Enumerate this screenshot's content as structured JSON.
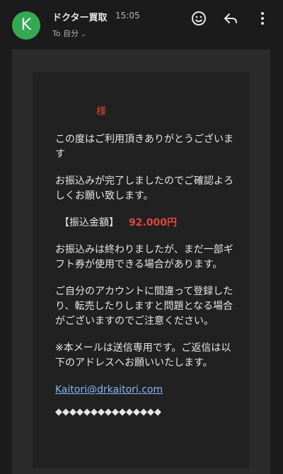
{
  "header": {
    "avatar_letter": "K",
    "sender": "ドクター買取",
    "time": "15:05",
    "to": "To 自分",
    "icons": [
      "smile-icon",
      "reply-icon",
      "more-vert-icon"
    ],
    "avatar_color": "#34a853"
  },
  "email": {
    "sama": "様",
    "para1": "この度はご利用頂きありがとうございます",
    "para2": "お振込みが完了しましたのでご確認よろしくお願い致します。",
    "amount_label": "【振込金額】",
    "amount_value": "92.000円",
    "para3": "お振込みは終わりましたが、まだ一部ギフト券が使用できる場合があります。",
    "para4": "ご自分のアカウントに間違って登録したり、転売したりしますと問題となる場合がございますのでご注意ください。",
    "para5": "※本メールは送信専用です。ご返信は以下のアドレスへお願いいたします。",
    "email_link": "Kaitori@drkaitori.com",
    "diamonds": "◆◆◆◆◆◆◆◆◆◆◆◆◆◆◆"
  }
}
